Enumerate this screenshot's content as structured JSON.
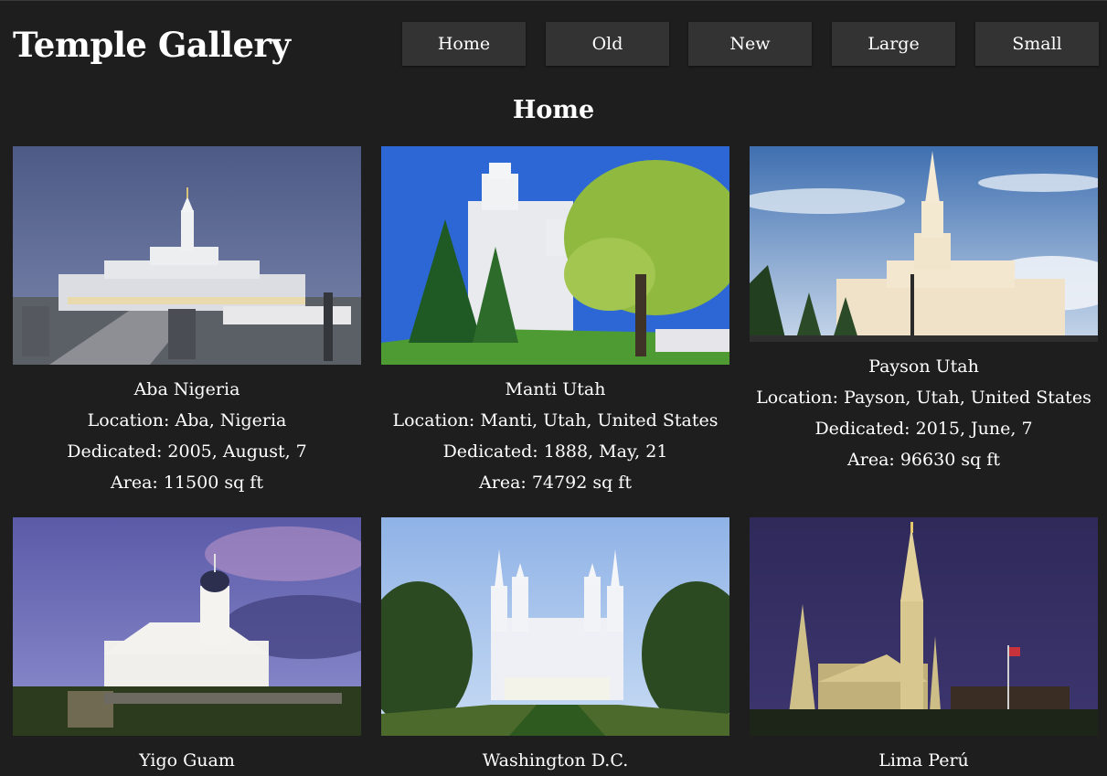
{
  "header": {
    "title": "Temple Gallery",
    "nav": [
      {
        "label": "Home"
      },
      {
        "label": "Old"
      },
      {
        "label": "New"
      },
      {
        "label": "Large"
      },
      {
        "label": "Small"
      }
    ]
  },
  "page_heading": "Home",
  "temples": [
    {
      "name": "Aba Nigeria",
      "location": "Location: Aba, Nigeria",
      "dedicated": "Dedicated: 2005, August, 7",
      "area": "Area: 11500 sq ft"
    },
    {
      "name": "Manti Utah",
      "location": "Location: Manti, Utah, United States",
      "dedicated": "Dedicated: 1888, May, 21",
      "area": "Area: 74792 sq ft"
    },
    {
      "name": "Payson Utah",
      "location": "Location: Payson, Utah, United States",
      "dedicated": "Dedicated: 2015, June, 7",
      "area": "Area: 96630 sq ft"
    },
    {
      "name": "Yigo Guam"
    },
    {
      "name": "Washington D.C."
    },
    {
      "name": "Lima Perú"
    }
  ],
  "colors": {
    "background": "#1e1e1e",
    "nav_button": "#333333",
    "text": "#ffffff"
  }
}
